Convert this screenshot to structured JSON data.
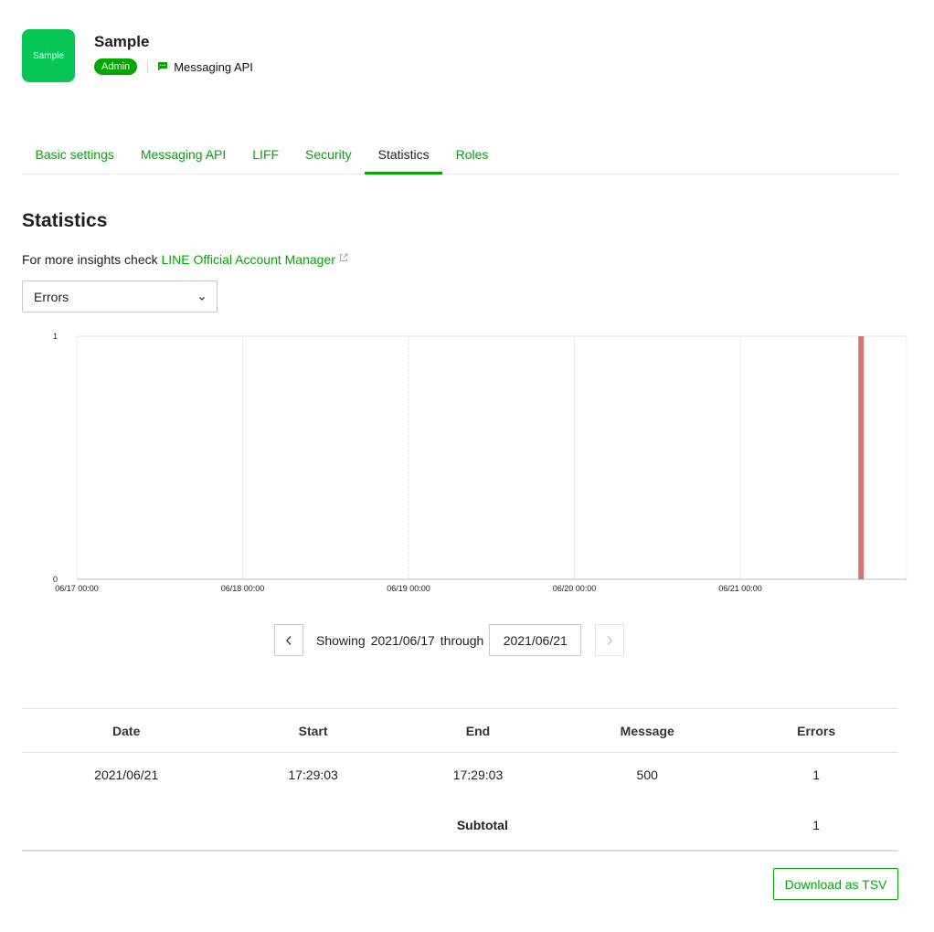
{
  "channel": {
    "icon_text": "Sample",
    "name": "Sample",
    "role_badge": "Admin",
    "channel_type": "Messaging API",
    "type_icon": "chat-bubble-icon"
  },
  "tabs": [
    {
      "label": "Basic settings",
      "active": false
    },
    {
      "label": "Messaging API",
      "active": false
    },
    {
      "label": "LIFF",
      "active": false
    },
    {
      "label": "Security",
      "active": false
    },
    {
      "label": "Statistics",
      "active": true
    },
    {
      "label": "Roles",
      "active": false
    }
  ],
  "page_title": "Statistics",
  "insight": {
    "text": "For more insights check ",
    "link_text": "LINE Official Account Manager",
    "icon": "external-link-icon"
  },
  "metric_select": {
    "value": "Errors"
  },
  "chart_data": {
    "type": "bar",
    "x_tick_labels": [
      "06/17 00:00",
      "06/18 00:00",
      "06/19 00:00",
      "06/20 00:00",
      "06/21 00:00"
    ],
    "y_tick_labels": [
      "1",
      "0"
    ],
    "ylim": [
      0,
      1
    ],
    "grid": true,
    "series": [
      {
        "values": [
          {
            "x": "2021/06/21 17:29",
            "y": 1
          }
        ]
      }
    ],
    "color": "#d17573"
  },
  "pager": {
    "showing_label": "Showing",
    "start_date": "2021/06/17",
    "through_label": "through",
    "end_date": "2021/06/21"
  },
  "table": {
    "headers": [
      "Date",
      "Start",
      "End",
      "Message",
      "Errors"
    ],
    "rows": [
      [
        "2021/06/21",
        "17:29:03",
        "17:29:03",
        "500",
        "1"
      ]
    ],
    "subtotal_label": "Subtotal",
    "subtotal_value": "1"
  },
  "download_label": "Download as TSV",
  "colors": {
    "brand_green": "#06c755",
    "link_green": "#00a800"
  }
}
